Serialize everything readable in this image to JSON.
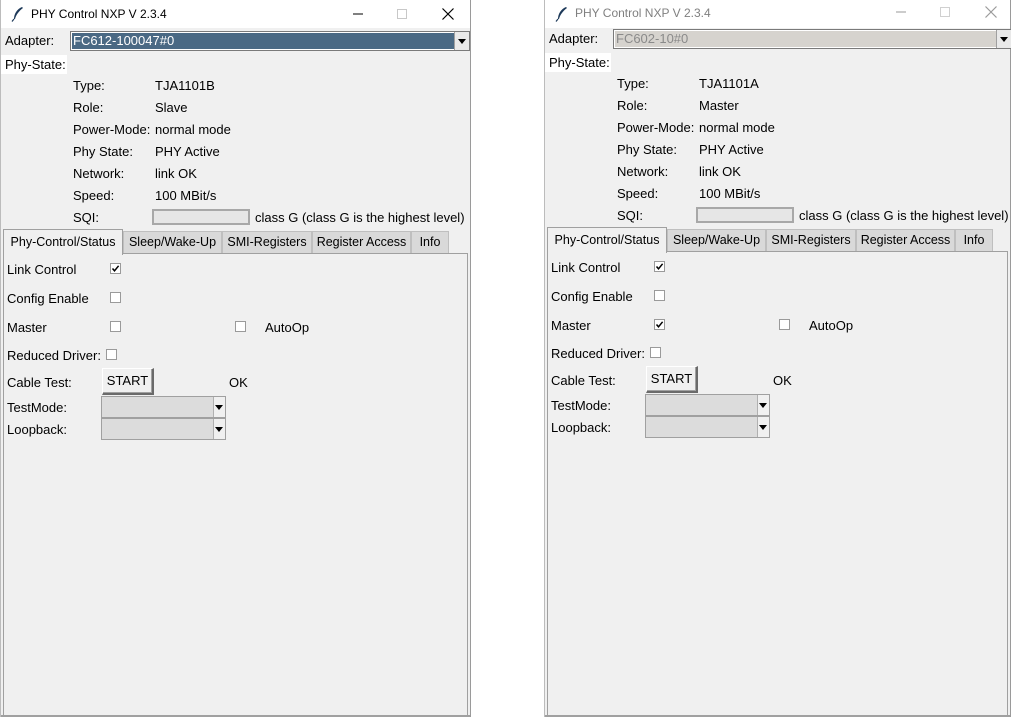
{
  "windows": [
    {
      "title": "PHY Control NXP V 2.3.4",
      "adapter_label": "Adapter:",
      "adapter_value": "FC612-100047#0",
      "phy_state_label": "Phy-State:",
      "info": {
        "type_label": "Type:",
        "type_value": "TJA1101B",
        "role_label": "Role:",
        "role_value": "Slave",
        "power_label": "Power-Mode:",
        "power_value": "normal mode",
        "phystate_label": "Phy State:",
        "phystate_value": "PHY Active",
        "network_label": "Network:",
        "network_value": "link OK",
        "speed_label": "Speed:",
        "speed_value": "100 MBit/s",
        "sqi_label": "SQI:",
        "sqi_value": "class G (class G is the highest level)",
        "sqi_fill": 0
      },
      "tabs": [
        "Phy-Control/Status",
        "Sleep/Wake-Up",
        "SMI-Registers",
        "Register Access",
        "Info"
      ],
      "active_tab": 0,
      "controls": {
        "link_control_label": "Link Control",
        "link_control_checked": true,
        "config_enable_label": "Config Enable",
        "config_enable_checked": false,
        "master_label": "Master",
        "master_checked": false,
        "autoop_label": "AutoOp",
        "autoop_checked": false,
        "reduced_driver_label": "Reduced Driver:",
        "reduced_driver_checked": false,
        "cable_test_label": "Cable Test:",
        "start_label": "START",
        "cable_result": "OK",
        "testmode_label": "TestMode:",
        "testmode_value": "",
        "loopback_label": "Loopback:",
        "loopback_value": ""
      }
    },
    {
      "title": "PHY Control NXP V 2.3.4",
      "adapter_label": "Adapter:",
      "adapter_value": "FC602-10#0",
      "phy_state_label": "Phy-State:",
      "info": {
        "type_label": "Type:",
        "type_value": "TJA1101A",
        "role_label": "Role:",
        "role_value": "Master",
        "power_label": "Power-Mode:",
        "power_value": "normal mode",
        "phystate_label": "Phy State:",
        "phystate_value": "PHY Active",
        "network_label": "Network:",
        "network_value": "link OK",
        "speed_label": "Speed:",
        "speed_value": "100 MBit/s",
        "sqi_label": "SQI:",
        "sqi_value": "class G (class G is the highest level)",
        "sqi_fill": 0
      },
      "tabs": [
        "Phy-Control/Status",
        "Sleep/Wake-Up",
        "SMI-Registers",
        "Register Access",
        "Info"
      ],
      "active_tab": 0,
      "controls": {
        "link_control_label": "Link Control",
        "link_control_checked": true,
        "config_enable_label": "Config Enable",
        "config_enable_checked": false,
        "master_label": "Master",
        "master_checked": true,
        "autoop_label": "AutoOp",
        "autoop_checked": false,
        "reduced_driver_label": "Reduced Driver:",
        "reduced_driver_checked": false,
        "cable_test_label": "Cable Test:",
        "start_label": "START",
        "cable_result": "OK",
        "testmode_label": "TestMode:",
        "testmode_value": "",
        "loopback_label": "Loopback:",
        "loopback_value": ""
      }
    }
  ],
  "colors": {
    "adapter_focused_bg": "#4a6984",
    "adapter_focused_text": "#ffffff",
    "adapter_disabled_bg": "#d6d3ce",
    "adapter_disabled_text": "#8a8a8a",
    "titlebar_active_text": "#000000",
    "titlebar_inactive_text": "#808080",
    "sqi_fill": "#06b025"
  }
}
